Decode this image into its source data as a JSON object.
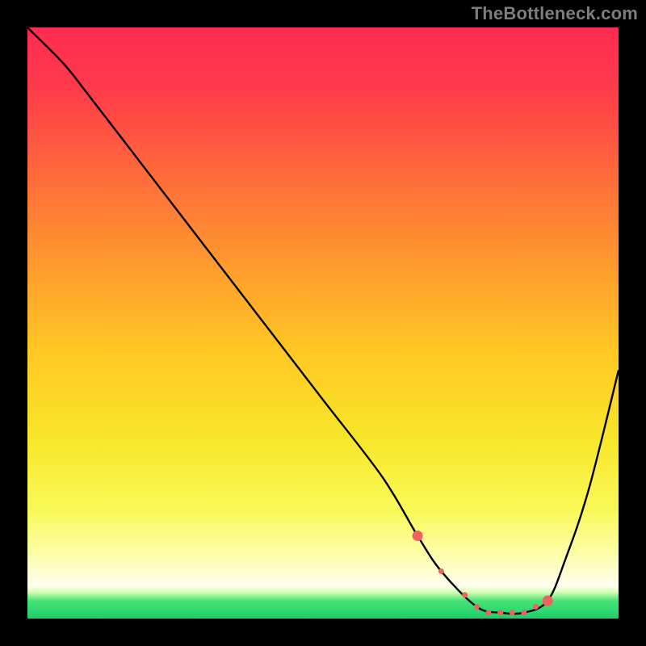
{
  "attribution": "TheBottleneck.com",
  "colors": {
    "background": "#000000",
    "attribution_text": "#7d7d7d",
    "curve": "#000000",
    "marker_fill": "#ef6262",
    "gradient_stops": [
      {
        "offset": 0.0,
        "color": "#ff2b52"
      },
      {
        "offset": 0.1,
        "color": "#ff3a4a"
      },
      {
        "offset": 0.25,
        "color": "#ff6a3b"
      },
      {
        "offset": 0.4,
        "color": "#ff9a2e"
      },
      {
        "offset": 0.55,
        "color": "#ffc823"
      },
      {
        "offset": 0.7,
        "color": "#f8e72a"
      },
      {
        "offset": 0.82,
        "color": "#faf95a"
      },
      {
        "offset": 0.9,
        "color": "#feffb4"
      },
      {
        "offset": 0.945,
        "color": "#fefff0"
      },
      {
        "offset": 0.955,
        "color": "#d6ffb4"
      },
      {
        "offset": 0.97,
        "color": "#46e377"
      },
      {
        "offset": 1.0,
        "color": "#1ecf6a"
      }
    ]
  },
  "chart_data": {
    "type": "line",
    "title": "",
    "xlabel": "",
    "ylabel": "",
    "xlim": [
      0,
      100
    ],
    "ylim": [
      0,
      100
    ],
    "series": [
      {
        "name": "bottleneck-curve",
        "x": [
          0,
          6,
          10,
          20,
          30,
          40,
          50,
          60,
          66,
          70,
          76,
          80,
          84,
          88,
          91,
          95,
          100
        ],
        "values": [
          100,
          94,
          89,
          76,
          63,
          50,
          37,
          24,
          14,
          8,
          2,
          1,
          1,
          3,
          10,
          22,
          42
        ]
      }
    ],
    "markers": {
      "name": "optimal-range-dots",
      "x": [
        66,
        70,
        74,
        76,
        78,
        80,
        82,
        84,
        86,
        88
      ],
      "values": [
        14,
        8,
        4,
        2,
        1,
        1,
        1,
        1,
        2,
        3
      ]
    }
  }
}
